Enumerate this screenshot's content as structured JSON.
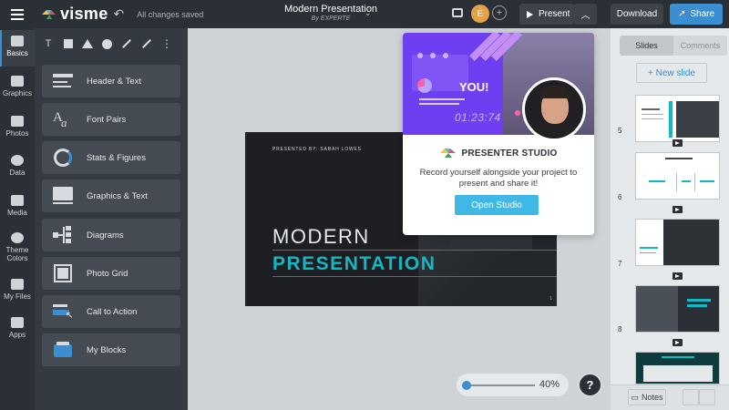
{
  "app": {
    "logo_text": "visme",
    "save_status": "All changes saved",
    "doc_title": "Modern Presentation",
    "doc_author": "By EXPERTE",
    "user_initial": "E",
    "present_label": "Present",
    "download_label": "Download",
    "share_label": "Share"
  },
  "rail": [
    {
      "label": "Basics",
      "icon": "basics-icon"
    },
    {
      "label": "Graphics",
      "icon": "graphics-icon"
    },
    {
      "label": "Photos",
      "icon": "photos-icon"
    },
    {
      "label": "Data",
      "icon": "data-icon"
    },
    {
      "label": "Media",
      "icon": "media-icon"
    },
    {
      "label": "Theme Colors",
      "icon": "palette-icon"
    },
    {
      "label": "My Files",
      "icon": "files-icon"
    },
    {
      "label": "Apps",
      "icon": "apps-icon"
    }
  ],
  "tools": {
    "text_tool": "T",
    "more": "⋮"
  },
  "panel_items": [
    {
      "label": "Header & Text",
      "icon": "header-text-icon"
    },
    {
      "label": "Font Pairs",
      "icon": "font-pairs-icon"
    },
    {
      "label": "Stats & Figures",
      "icon": "stats-icon"
    },
    {
      "label": "Graphics & Text",
      "icon": "graphics-text-icon"
    },
    {
      "label": "Diagrams",
      "icon": "diagram-icon"
    },
    {
      "label": "Photo Grid",
      "icon": "photo-grid-icon"
    },
    {
      "label": "Call to Action",
      "icon": "cta-icon"
    },
    {
      "label": "My Blocks",
      "icon": "blocks-icon"
    }
  ],
  "slide": {
    "presented_by": "PRESENTED BY: SARAH LOWES",
    "line1": "MODERN",
    "line2": "PRESENTATION",
    "accent": "#14b8c4",
    "page": "1"
  },
  "popup": {
    "hero_text": "YOU!",
    "hero_time": "01:23:74",
    "brand": "PRESENTER STUDIO",
    "description": "Record yourself alongside your project to present and share it!",
    "button": "Open Studio",
    "accent": "#6d3ff0"
  },
  "zoom": {
    "value": "40%",
    "level": 0.4
  },
  "help_label": "?",
  "right_panel": {
    "tab_slides": "Slides",
    "tab_comments": "Comments",
    "new_slide": "+ New slide",
    "thumbnails": [
      "5",
      "6",
      "7",
      "8"
    ],
    "notes_label": "Notes"
  },
  "colors": {
    "topbar": "#2b3036",
    "primary": "#3b8ed0",
    "teal": "#14b8c4"
  }
}
